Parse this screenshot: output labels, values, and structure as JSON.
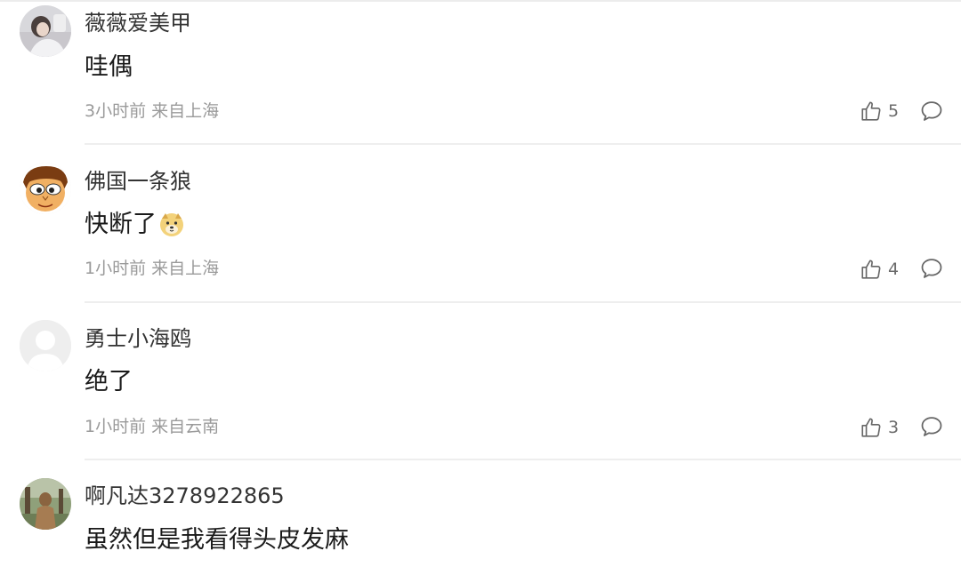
{
  "comments": [
    {
      "username": "薇薇爱美甲",
      "content": "哇偶",
      "time": "3小时前",
      "location": "来自上海",
      "likes": "5",
      "avatar_icon": "avatar-photo-icon"
    },
    {
      "username": "佛国一条狼",
      "content": "快断了",
      "emoji_icon": "doge-emoji-icon",
      "time": "1小时前",
      "location": "来自上海",
      "likes": "4",
      "avatar_icon": "avatar-cartoon-icon"
    },
    {
      "username": "勇士小海鸥",
      "content": "绝了",
      "time": "1小时前",
      "location": "来自云南",
      "likes": "3",
      "avatar_icon": "avatar-default-icon"
    },
    {
      "username": "啊凡达3278922865",
      "content": "虽然但是我看得头皮发麻",
      "avatar_icon": "avatar-photo-icon"
    }
  ],
  "icons": {
    "like": "thumbs-up-icon",
    "reply": "comment-bubble-icon"
  },
  "colors": {
    "meta_text": "#9a9a9a",
    "username": "#333333",
    "content": "#1a1a1a",
    "divider": "#eeeeee"
  }
}
